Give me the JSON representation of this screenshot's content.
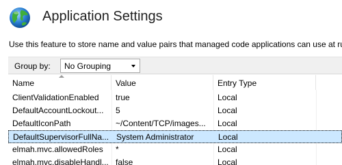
{
  "header": {
    "title": "Application Settings",
    "icon": "globe-icon"
  },
  "description": "Use this feature to store name and value pairs that managed code applications can use at ru",
  "toolbar": {
    "group_by_label": "Group by:",
    "group_by_value": "No Grouping"
  },
  "grid": {
    "columns": [
      "Name",
      "Value",
      "Entry Type"
    ],
    "rows": [
      {
        "name": "ClientValidationEnabled",
        "value": "true",
        "entry_type": "Local"
      },
      {
        "name": "DefaultAccountLockout...",
        "value": "5",
        "entry_type": "Local"
      },
      {
        "name": "DefaultIconPath",
        "value": "~/Content/TCP/images...",
        "entry_type": "Local"
      },
      {
        "name": "DefaultSupervisorFullNa...",
        "value": "System Administrator",
        "entry_type": "Local"
      },
      {
        "name": "elmah.mvc.allowedRoles",
        "value": "*",
        "entry_type": "Local"
      },
      {
        "name": "elmah.mvc.disableHandl...",
        "value": "false",
        "entry_type": "Local"
      }
    ],
    "selected_row_index": 3
  },
  "colors": {
    "selection": "#cce8ff",
    "toolbar_bg": "#f0f0f0"
  }
}
